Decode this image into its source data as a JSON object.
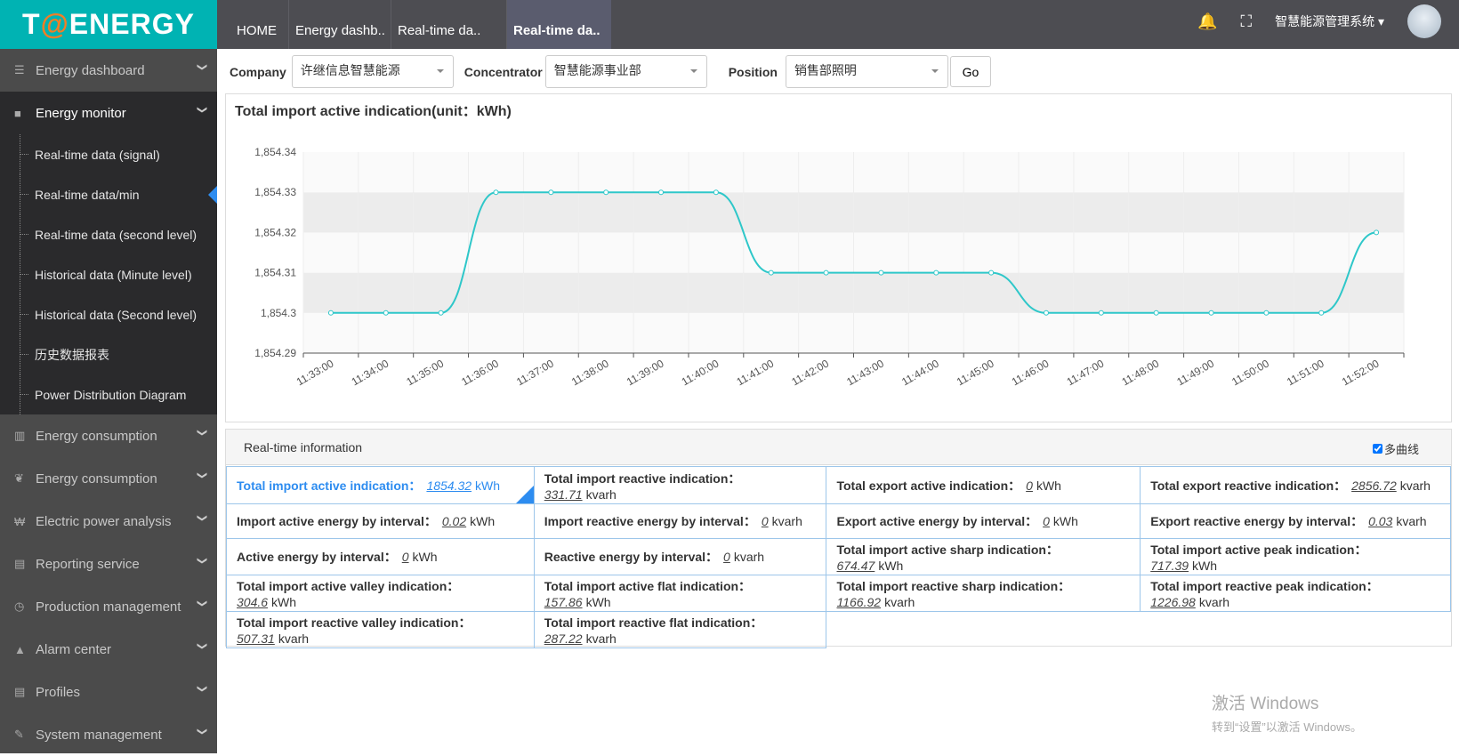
{
  "logo": {
    "text_pre": "T",
    "text_at": "@",
    "text_post": "ENERGY"
  },
  "tabs": [
    {
      "label": "HOME"
    },
    {
      "label": "Energy dashb.."
    },
    {
      "label": "Real-time da.."
    },
    {
      "label": "Real-time da..",
      "active": true
    }
  ],
  "header": {
    "system_name": "智慧能源管理系统",
    "icons": [
      "bell-icon",
      "fullscreen-icon",
      "avatar"
    ]
  },
  "sidebar": {
    "top": [
      {
        "label": "Energy dashboard",
        "icon": "☰"
      },
      {
        "label": "Energy monitor",
        "icon": "■",
        "open": true
      }
    ],
    "sub": [
      {
        "label": "Real-time data (signal)"
      },
      {
        "label": "Real-time data/min",
        "current": true
      },
      {
        "label": "Real-time data (second level)"
      },
      {
        "label": "Historical data (Minute level)"
      },
      {
        "label": "Historical data (Second level)"
      },
      {
        "label": "历史数据报表"
      },
      {
        "label": "Power Distribution Diagram"
      }
    ],
    "bottom": [
      {
        "label": "Energy consumption",
        "icon": "▥"
      },
      {
        "label": "Energy consumption",
        "icon": "❦"
      },
      {
        "label": "Electric power analysis",
        "icon": "₩"
      },
      {
        "label": "Reporting service",
        "icon": "▤"
      },
      {
        "label": "Production management",
        "icon": "◷"
      },
      {
        "label": "Alarm center",
        "icon": "▲"
      },
      {
        "label": "Profiles",
        "icon": "▤"
      },
      {
        "label": "System management",
        "icon": "✎"
      }
    ]
  },
  "filters": {
    "company_label": "Company",
    "company_value": "许继信息智慧能源",
    "concentrator_label": "Concentrator",
    "concentrator_value": "智慧能源事业部",
    "position_label": "Position",
    "position_value": "销售部照明",
    "go_label": "Go"
  },
  "chart_data": {
    "type": "line",
    "title": "Total import active indication(unit：kWh)",
    "x": [
      "11:33:00",
      "11:34:00",
      "11:35:00",
      "11:36:00",
      "11:37:00",
      "11:38:00",
      "11:39:00",
      "11:40:00",
      "11:41:00",
      "11:42:00",
      "11:43:00",
      "11:44:00",
      "11:45:00",
      "11:46:00",
      "11:47:00",
      "11:48:00",
      "11:49:00",
      "11:50:00",
      "11:51:00",
      "11:52:00"
    ],
    "values": [
      1854.3,
      1854.3,
      1854.3,
      1854.33,
      1854.33,
      1854.33,
      1854.33,
      1854.33,
      1854.31,
      1854.31,
      1854.31,
      1854.31,
      1854.31,
      1854.3,
      1854.3,
      1854.3,
      1854.3,
      1854.3,
      1854.3,
      1854.32
    ],
    "ylim": [
      1854.29,
      1854.34
    ],
    "yticks": [
      "1,854.29",
      "1,854.3",
      "1,854.31",
      "1,854.32",
      "1,854.33",
      "1,854.34"
    ],
    "color": "#2ec7c9",
    "smooth": true,
    "grid": "alternating bands"
  },
  "realtime": {
    "title": "Real-time information",
    "multi_curve_label": "多曲线",
    "multi_curve_checked": true,
    "rows": [
      [
        {
          "label": "Total import active indication：",
          "value": "1854.32",
          "unit": "kWh",
          "highlight": true
        },
        {
          "label": "Total import reactive indication：",
          "value": "331.71",
          "unit": "kvarh",
          "wrap": true
        },
        {
          "label": "Total export active indication：",
          "value": "0",
          "unit": "kWh"
        },
        {
          "label": "Total export reactive indication：",
          "value": "2856.72",
          "unit": "kvarh"
        }
      ],
      [
        {
          "label": "Import active energy by interval：",
          "value": "0.02",
          "unit": "kWh"
        },
        {
          "label": "Import reactive energy by interval：",
          "value": "0",
          "unit": "kvarh"
        },
        {
          "label": "Export active energy by interval：",
          "value": "0",
          "unit": "kWh"
        },
        {
          "label": "Export reactive energy by interval：",
          "value": "0.03",
          "unit": "kvarh"
        }
      ],
      [
        {
          "label": "Active energy by interval：",
          "value": "0",
          "unit": "kWh"
        },
        {
          "label": "Reactive energy by interval：",
          "value": "0",
          "unit": "kvarh"
        },
        {
          "label": "Total import active sharp indication：",
          "value": "674.47",
          "unit": "kWh",
          "wrap": true
        },
        {
          "label": "Total import active peak indication：",
          "value": "717.39",
          "unit": "kWh",
          "wrap": true
        }
      ],
      [
        {
          "label": "Total import active valley indication：",
          "value": "304.6",
          "unit": "kWh",
          "wrap": true
        },
        {
          "label": "Total import active flat indication：",
          "value": "157.86",
          "unit": "kWh",
          "wrap": true
        },
        {
          "label": "Total import reactive sharp indication：",
          "value": "1166.92",
          "unit": "kvarh",
          "wrap": true
        },
        {
          "label": "Total import reactive peak indication：",
          "value": "1226.98",
          "unit": "kvarh",
          "wrap": true
        }
      ],
      [
        {
          "label": "Total import reactive valley indication：",
          "value": "507.31",
          "unit": "kvarh",
          "wrap": true
        },
        {
          "label": "Total import reactive flat indication：",
          "value": "287.22",
          "unit": "kvarh",
          "wrap": true
        }
      ]
    ]
  },
  "watermark": {
    "line1": "激活 Windows",
    "line2": "转到“设置”以激活 Windows。"
  }
}
